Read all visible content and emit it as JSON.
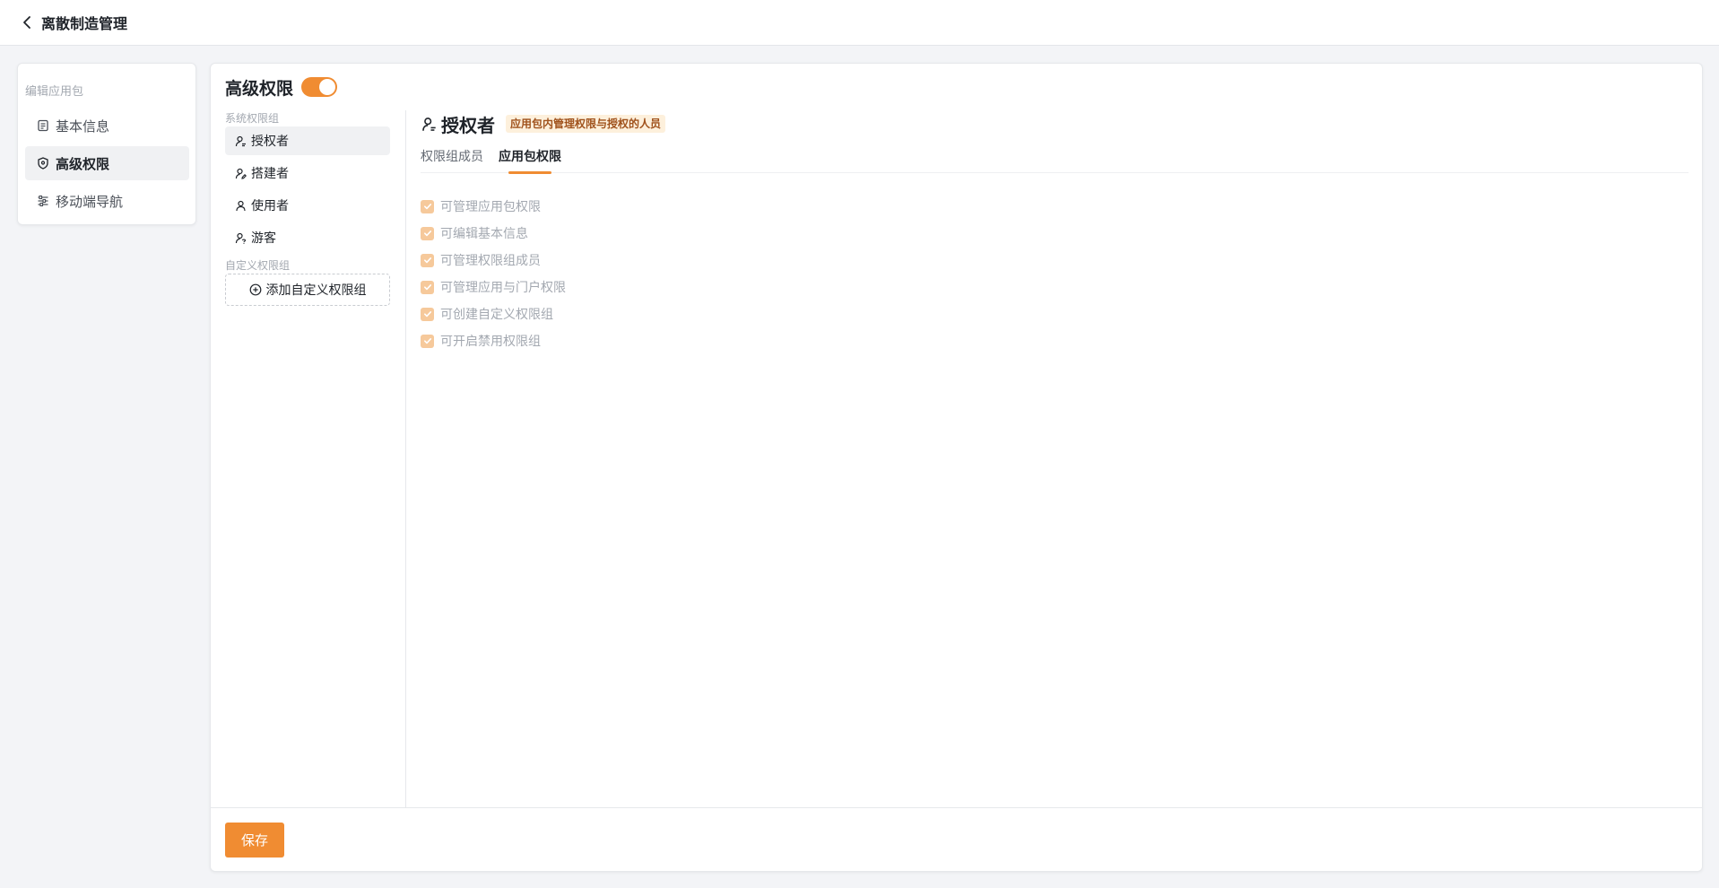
{
  "header": {
    "title": "离散制造管理",
    "back_icon": "chevron-left-icon"
  },
  "sidebar": {
    "section_label": "编辑应用包",
    "items": [
      {
        "label": "基本信息",
        "icon": "document-icon",
        "active": false
      },
      {
        "label": "高级权限",
        "icon": "shield-icon",
        "active": true
      },
      {
        "label": "移动端导航",
        "icon": "sliders-icon",
        "active": false
      }
    ]
  },
  "main": {
    "title": "高级权限",
    "toggle_on": true,
    "system_groups_label": "系统权限组",
    "system_groups": [
      {
        "label": "授权者",
        "active": true
      },
      {
        "label": "搭建者",
        "active": false
      },
      {
        "label": "使用者",
        "active": false
      },
      {
        "label": "游客",
        "active": false
      }
    ],
    "custom_groups_label": "自定义权限组",
    "add_custom_group": "添加自定义权限组",
    "detail": {
      "title": "授权者",
      "badge": "应用包内管理权限与授权的人员",
      "tabs": [
        {
          "label": "权限组成员",
          "active": false
        },
        {
          "label": "应用包权限",
          "active": true
        }
      ],
      "permissions": [
        {
          "label": "可管理应用包权限",
          "checked": true
        },
        {
          "label": "可编辑基本信息",
          "checked": true
        },
        {
          "label": "可管理权限组成员",
          "checked": true
        },
        {
          "label": "可管理应用与门户权限",
          "checked": true
        },
        {
          "label": "可创建自定义权限组",
          "checked": true
        },
        {
          "label": "可开启禁用权限组",
          "checked": true
        }
      ]
    }
  },
  "footer": {
    "save_label": "保存"
  },
  "colors": {
    "accent": "#f08c32",
    "badge_bg": "#fdf0dc",
    "badge_text": "#a0521c",
    "checkbox_disabled": "#f6c99b"
  }
}
